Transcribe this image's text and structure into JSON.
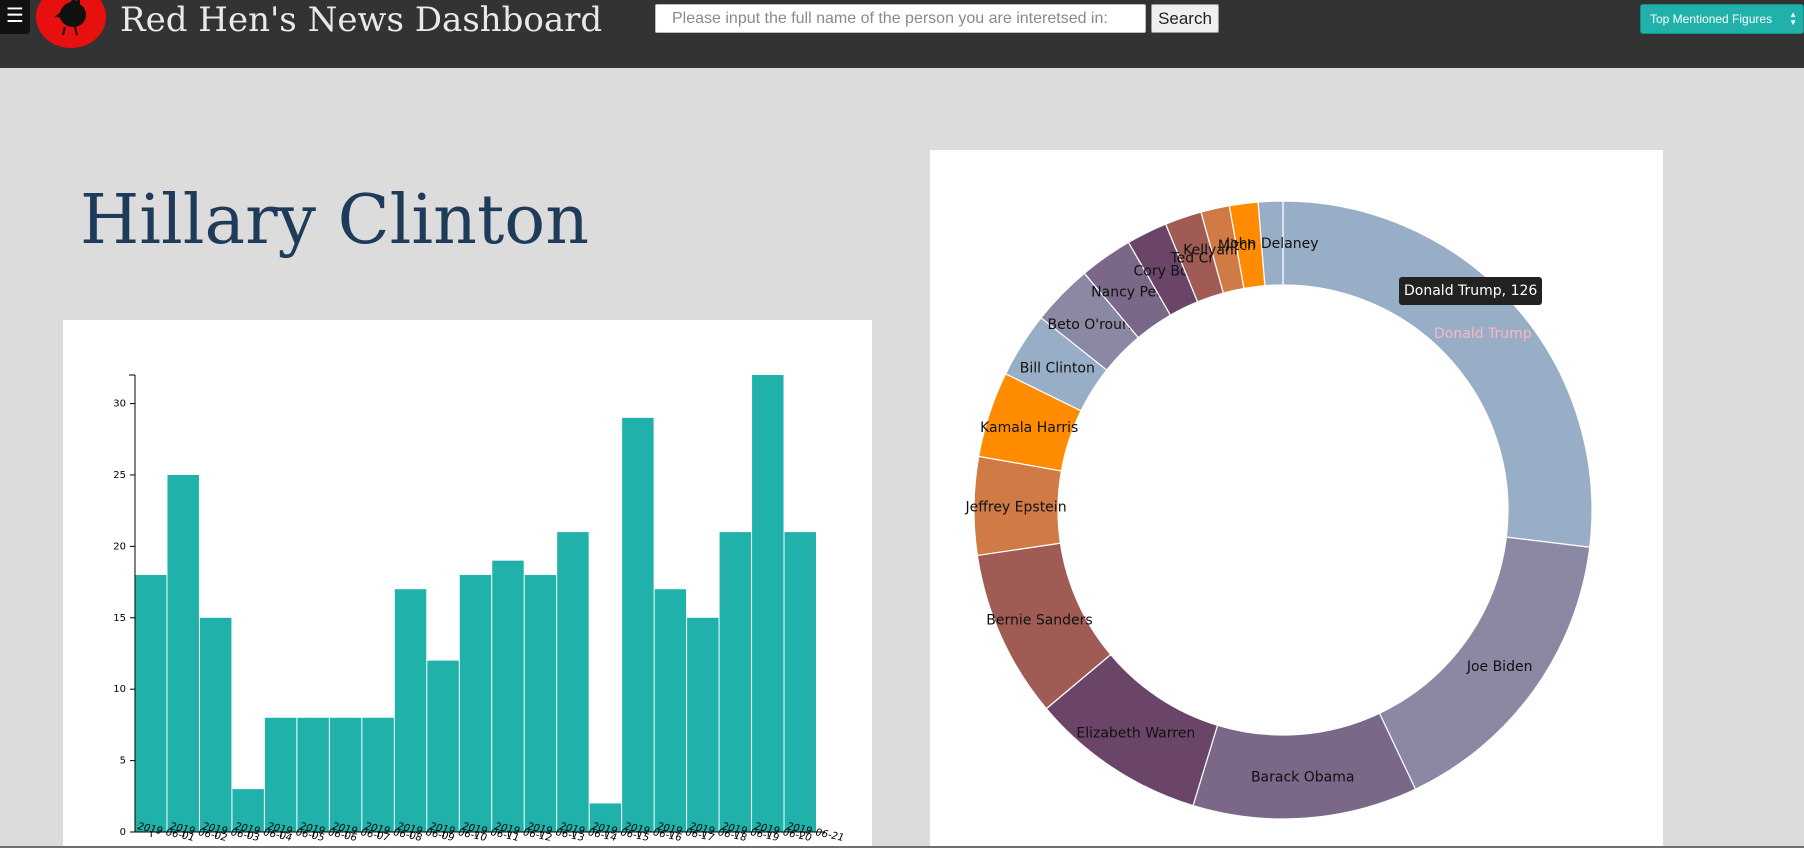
{
  "header": {
    "menu_icon": "☰",
    "logo_icon": "rooster-icon",
    "title": "Red Hen's News Dashboard",
    "search_placeholder": "Please input the full name of the person you are interetsed in:",
    "search_button": "Search",
    "figures_select": "Top Mentioned Figures"
  },
  "person": {
    "name": "Hillary Clinton"
  },
  "colors": {
    "bar": "#20b2aa",
    "header_bg": "#333333",
    "page_bg": "#dcdcdc",
    "logo": "#e8100e",
    "title_text": "#1f3b5a"
  },
  "tooltip": {
    "text": "Donald Trump, 126"
  },
  "chart_data": [
    {
      "type": "bar",
      "categories": [
        "2019-06-01",
        "2019-06-02",
        "2019-06-03",
        "2019-06-04",
        "2019-06-05",
        "2019-06-06",
        "2019-06-07",
        "2019-06-08",
        "2019-06-09",
        "2019-06-10",
        "2019-06-11",
        "2019-06-12",
        "2019-06-13",
        "2019-06-14",
        "2019-06-15",
        "2019-06-16",
        "2019-06-17",
        "2019-06-18",
        "2019-06-19",
        "2019-06-20",
        "2019-06-21"
      ],
      "values": [
        18,
        25,
        15,
        3,
        8,
        8,
        8,
        8,
        17,
        12,
        18,
        19,
        18,
        21,
        2,
        29,
        17,
        15,
        21,
        32,
        21
      ],
      "x_tick_labels": [
        "2019-06-01",
        "2019-06-02",
        "2019-06-03",
        "2019-06-04",
        "2019-06-05",
        "2019-06-06",
        "2019-06-07",
        "2019-06-08",
        "2019-06-09",
        "2019-06-10",
        "2019-06-11",
        "2019-06-12",
        "2019-06-13",
        "2019-06-14",
        "2019-06-15",
        "2019-06-16",
        "2019-06-17",
        "2019-06-18",
        "2019-06-19",
        "2019-06-20",
        "2019-06-21"
      ],
      "y_ticks": [
        0,
        5,
        10,
        15,
        20,
        25,
        30
      ],
      "ylim": [
        0,
        32
      ],
      "title": "",
      "xlabel": "",
      "ylabel": "",
      "grid": false
    },
    {
      "type": "pie",
      "donut": true,
      "slices": [
        {
          "label": "Donald Trump",
          "value": 126,
          "color": "#98aec6",
          "label_color": "#ffb6c1"
        },
        {
          "label": "Joe Biden",
          "value": 75,
          "color": "#8b88a4",
          "label_color": "#111111"
        },
        {
          "label": "Barack Obama",
          "value": 55,
          "color": "#7b6787",
          "label_color": "#111111"
        },
        {
          "label": "Elizabeth Warren",
          "value": 43,
          "color": "#6b4568",
          "label_color": "#111111"
        },
        {
          "label": "Bernie Sanders",
          "value": 41,
          "color": "#a05b54",
          "label_color": "#111111"
        },
        {
          "label": "Jeffrey Epstein",
          "value": 24,
          "color": "#d07a45",
          "label_color": "#111111"
        },
        {
          "label": "Kamala Harris",
          "value": 21,
          "color": "#ff8c00",
          "label_color": "#111111"
        },
        {
          "label": "Bill Clinton",
          "value": 16,
          "color": "#98aec6",
          "label_color": "#111111"
        },
        {
          "label": "Beto O'rourk",
          "value": 15,
          "color": "#8b88a4",
          "label_color": "#111111"
        },
        {
          "label": "Nancy Pelo",
          "value": 13,
          "color": "#7b6787",
          "label_color": "#111111"
        },
        {
          "label": "Cory Boo",
          "value": 10,
          "color": "#6b4568",
          "label_color": "#111111"
        },
        {
          "label": "Ted Cru",
          "value": 9,
          "color": "#a05b54",
          "label_color": "#111111"
        },
        {
          "label": "Kellyanne C",
          "value": 7,
          "color": "#d07a45",
          "label_color": "#111111"
        },
        {
          "label": "Mitch Mc",
          "value": 7,
          "color": "#ff8c00",
          "label_color": "#111111"
        },
        {
          "label": "John Delaney",
          "value": 6,
          "color": "#98aec6",
          "label_color": "#111111"
        }
      ]
    }
  ]
}
